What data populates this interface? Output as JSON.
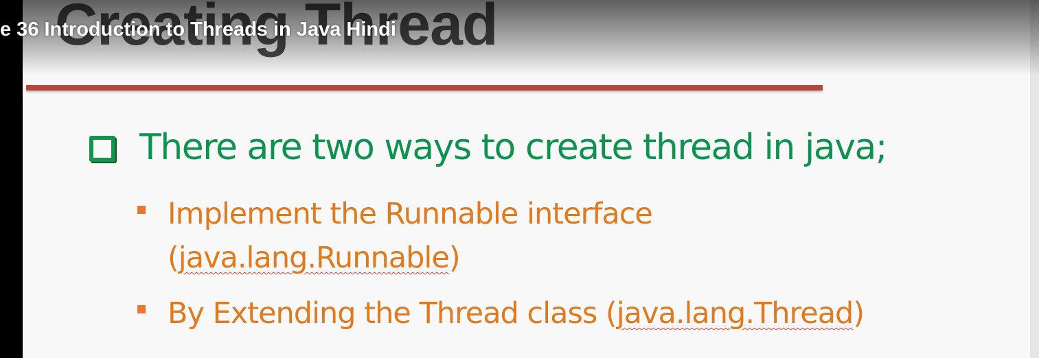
{
  "video": {
    "title": "e 36 Introduction to Threads in Java Hindi"
  },
  "slide": {
    "heading": "Creating Thread",
    "main_point": "There are two ways to create thread in java;",
    "sub_points": [
      {
        "line1": "Implement the Runnable interface",
        "line2_prefix": "(",
        "line2_code": "java.lang.Runnable",
        "line2_suffix": ")"
      },
      {
        "text": "By Extending the Thread class (",
        "code": "java.lang.Thread",
        "suffix": ")"
      }
    ]
  },
  "icons": {
    "main_bullet": "checkbox-icon",
    "sub_bullet": "square-bullet-icon"
  },
  "colors": {
    "heading_rule": "#b4473d",
    "main_text": "#0f9150",
    "sub_text": "#e07a1f",
    "heading_text": "#4a4a4a"
  }
}
